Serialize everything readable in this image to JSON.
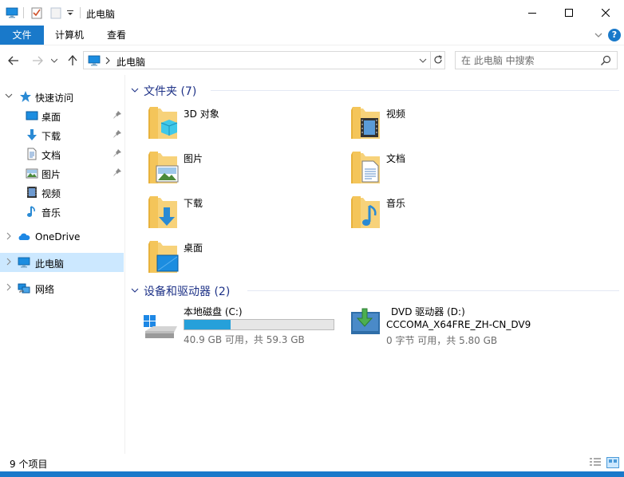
{
  "window": {
    "title": "此电脑"
  },
  "ribbon": {
    "tabs": [
      {
        "label": "文件"
      },
      {
        "label": "计算机"
      },
      {
        "label": "查看"
      }
    ],
    "help_label": "?"
  },
  "address": {
    "path": "此电脑"
  },
  "search": {
    "placeholder": "在 此电脑 中搜索"
  },
  "sidebar": {
    "items": [
      {
        "label": "快速访问"
      },
      {
        "label": "桌面"
      },
      {
        "label": "下载"
      },
      {
        "label": "文档"
      },
      {
        "label": "图片"
      },
      {
        "label": "视频"
      },
      {
        "label": "音乐"
      },
      {
        "label": "OneDrive"
      },
      {
        "label": "此电脑"
      },
      {
        "label": "网络"
      }
    ]
  },
  "folders_group": {
    "title": "文件夹 (7)",
    "items": [
      {
        "label": "3D 对象"
      },
      {
        "label": "视频"
      },
      {
        "label": "图片"
      },
      {
        "label": "文档"
      },
      {
        "label": "下载"
      },
      {
        "label": "音乐"
      },
      {
        "label": "桌面"
      }
    ]
  },
  "drives_group": {
    "title": "设备和驱动器 (2)",
    "drives": [
      {
        "label": "本地磁盘 (C:)",
        "free_text": "40.9 GB 可用，共 59.3 GB",
        "used_fraction": 0.31
      },
      {
        "label": "DVD 驱动器 (D:)",
        "volume": "CCCOMA_X64FRE_ZH-CN_DV9",
        "free_text": "0 字节 可用，共 5.80 GB"
      }
    ]
  },
  "status": {
    "item_count": "9 个项目"
  },
  "colors": {
    "accent": "#1979ca",
    "folder": "#f4c55a",
    "selected": "#cce8ff",
    "progress": "#26a0da",
    "group_header": "#1e3287"
  }
}
